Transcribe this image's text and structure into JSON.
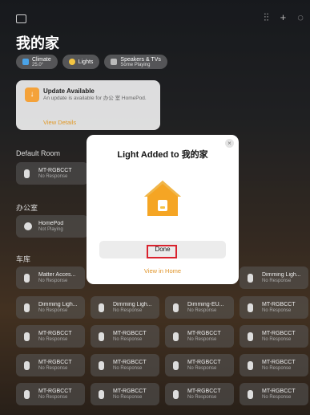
{
  "header": {
    "home_name": "我的家"
  },
  "toolbar": {
    "icons": [
      "sidebar-icon",
      "waveform-icon",
      "plus-icon",
      "more-icon"
    ]
  },
  "pills": [
    {
      "label": "Climate",
      "sub": "25.0°"
    },
    {
      "label": "Lights",
      "sub": ""
    },
    {
      "label": "Speakers & TVs",
      "sub": "Some Playing"
    }
  ],
  "update_card": {
    "title": "Update Available",
    "desc": "An update is available for 办公 室 HomePod.",
    "link": "View Details"
  },
  "sections": {
    "default_room": "Default Room",
    "office": "办公室",
    "garage": "车库"
  },
  "default_room_tile": {
    "name": "MT-RGBCCT",
    "status": "No Response"
  },
  "office_tile": {
    "name": "HomePod",
    "status": "Not Playing"
  },
  "grid": [
    [
      "Matter Acces...",
      "",
      "",
      "Dimming Ligh..."
    ],
    [
      "Dimming Ligh...",
      "Dimming Ligh...",
      "Dimming-EU...",
      "MT-RGBCCT"
    ],
    [
      "MT-RGBCCT",
      "MT-RGBCCT",
      "MT-RGBCCT",
      "MT-RGBCCT"
    ],
    [
      "MT-RGBCCT",
      "MT-RGBCCT",
      "MT-RGBCCT",
      "MT-RGBCCT"
    ],
    [
      "MT-RGBCCT",
      "MT-RGBCCT",
      "MT-RGBCCT",
      "MT-RGBCCT"
    ]
  ],
  "grid_status": "No Response",
  "modal": {
    "title": "Light Added to 我的家",
    "done": "Done",
    "view": "View in Home"
  },
  "colors": {
    "accent": "#e0952a",
    "highlight": "#d9232e"
  }
}
